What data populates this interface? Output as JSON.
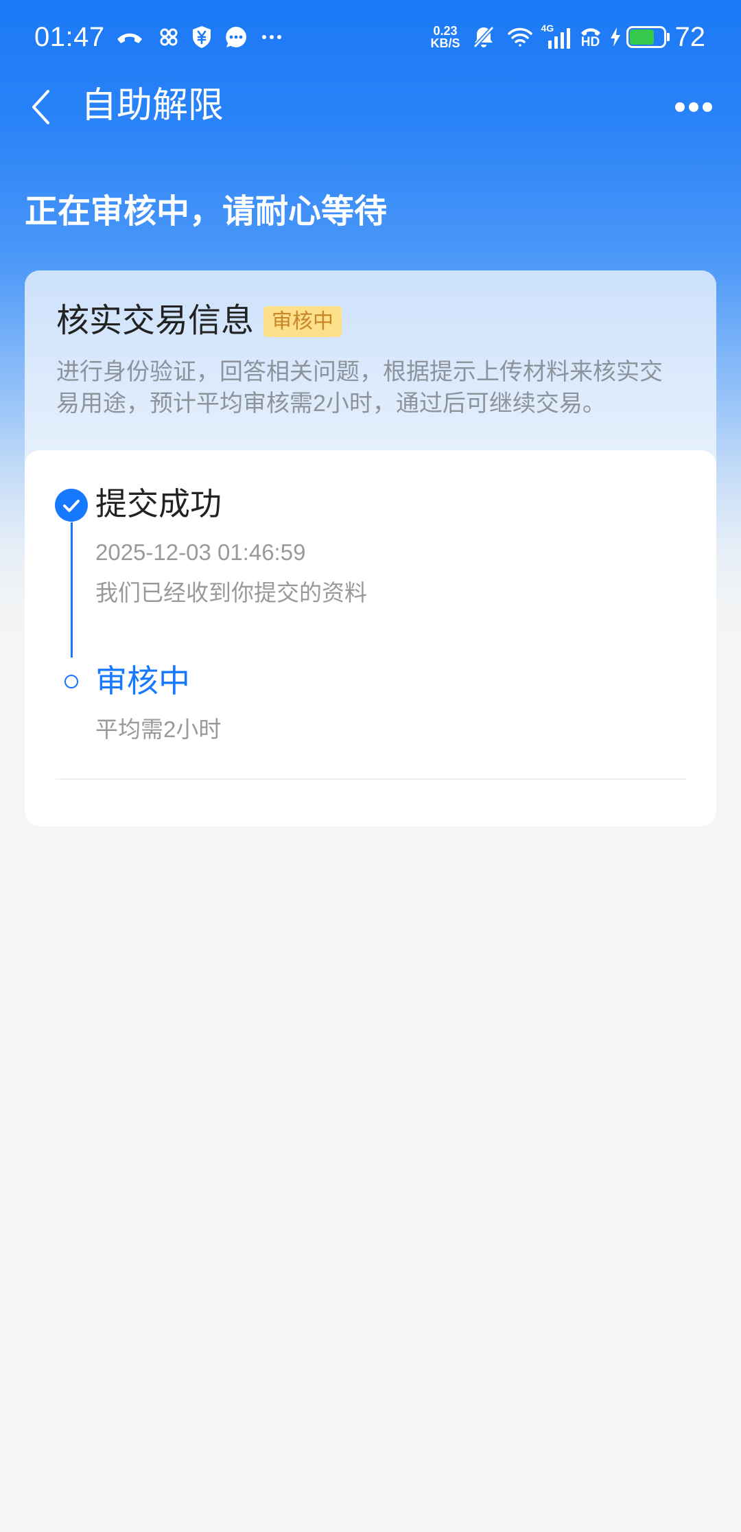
{
  "status_bar": {
    "time": "01:47",
    "left_icons": [
      "phone-icon",
      "china-unicom-icon",
      "shield-yuan-icon",
      "message-icon",
      "more-notifications-icon"
    ],
    "net_speed": {
      "value": "0.23",
      "unit": "KB/S"
    },
    "right_icons": [
      "bell-muted-icon",
      "wifi-icon",
      "signal-icon",
      "hd-call-icon",
      "charging-icon",
      "battery-icon"
    ],
    "network_type": "4G",
    "hd_label": "HD",
    "battery": {
      "percent": "72"
    }
  },
  "header": {
    "back_icon": "chevron-left-icon",
    "title": "自助解限",
    "menu_icon": "more-horizontal-icon"
  },
  "banner": {
    "headline": "正在审核中，请耐心等待"
  },
  "card": {
    "title": "核实交易信息",
    "badge": "审核中",
    "description": "进行身份验证，回答相关问题，根据提示上传材料来核实交易用途，预计平均审核需2小时，通过后可继续交易。"
  },
  "timeline": {
    "steps": [
      {
        "icon": "check-circle-icon",
        "title": "提交成功",
        "time": "2025-12-03 01:46:59",
        "detail": "我们已经收到你提交的资料"
      },
      {
        "icon": "hollow-circle-icon",
        "title": "审核中",
        "detail": "平均需2小时"
      }
    ]
  },
  "theme": {
    "primary": "#1677ff",
    "header_bg": "#1b79f6",
    "badge_bg": "#ffe08a",
    "badge_text": "#c6862a",
    "battery_fill": "#36c94c",
    "text_primary": "#222222",
    "text_secondary": "#999999",
    "text_description": "#8d939b"
  }
}
